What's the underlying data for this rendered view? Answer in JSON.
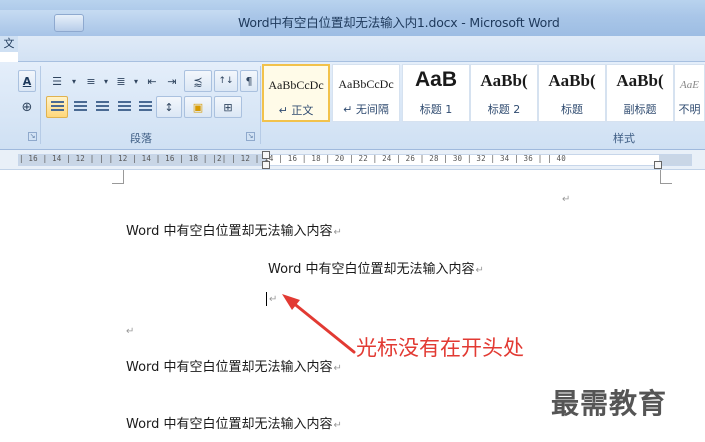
{
  "window": {
    "title": "Word中有空白位置却无法输入内1.docx - Microsoft Word"
  },
  "menu": {
    "app_glyph": "文"
  },
  "ribbon": {
    "paragraph_group": {
      "label": "段落",
      "row1_glyphs": [
        "☰",
        "≡",
        "≣",
        "⇤",
        "⇥",
        "⪷",
        "↑↓",
        "¶"
      ],
      "row2_glyphs": [
        "≡",
        "≡",
        "≡",
        "≡",
        "≣",
        "↕",
        "▣",
        "⊞"
      ]
    },
    "font_group_glyphs": [
      "A",
      "⊕"
    ],
    "styles_group": {
      "label": "样式",
      "items": [
        {
          "preview": "AaBbCcDc",
          "name": "↵ 正文",
          "selected": true
        },
        {
          "preview": "AaBbCcDc",
          "name": "↵ 无间隔",
          "selected": false
        },
        {
          "preview": "AaB",
          "name": "标题 1",
          "selected": false
        },
        {
          "preview": "AaBb(",
          "name": "标题 2",
          "selected": false
        },
        {
          "preview": "AaBb(",
          "name": "标题",
          "selected": false
        },
        {
          "preview": "AaBb(",
          "name": "副标题",
          "selected": false
        },
        {
          "preview": "AaE",
          "name": "不明",
          "selected": false
        }
      ]
    }
  },
  "ruler": {
    "numbers": "| 16 | 14 | 12 |   |  | 12 | 14 | 16 | 18 |  |2| | 12 | 14 | 16 | 18 | 20 | 22 | 24 | 26 | 28 | 30 | 32 | 34 | 36 |   | 40"
  },
  "document": {
    "paragraph_mark": "↵",
    "line1": "Word 中有空白位置却无法输入内容",
    "line2": "Word 中有空白位置却无法输入内容",
    "line3": "Word 中有空白位置却无法输入内容",
    "line4": "Word 中有空白位置却无法输入内容"
  },
  "annotation": {
    "text": "光标没有在开头处",
    "color": "#e23a33"
  },
  "watermark": {
    "text": "最需教育"
  },
  "colors": {
    "accent_selected_style": "#f2c24b",
    "ribbon_blue": "#d8e6f6",
    "annotation_red": "#e23a33"
  }
}
